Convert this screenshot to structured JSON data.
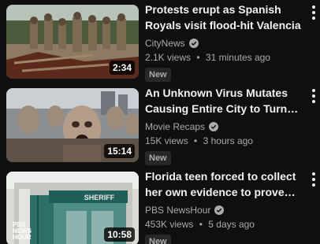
{
  "videos": [
    {
      "title": "Protests erupt as Spanish Royals visit flood-hit Valencia",
      "channel": "CityNews",
      "views": "2.1K views",
      "age": "31 minutes ago",
      "badge": "New",
      "duration": "2:34",
      "verified": true
    },
    {
      "title": "An Unknown Virus Mutates Causing Entire City to Turn Int…",
      "channel": "Movie Recaps",
      "views": "15K views",
      "age": "3 hours ago",
      "badge": "New",
      "duration": "15:14",
      "verified": true
    },
    {
      "title": "Florida teen forced to collect her own evidence to prove she…",
      "channel": "PBS NewsHour",
      "views": "453K views",
      "age": "5 days ago",
      "badge": "New",
      "duration": "10:58",
      "verified": true,
      "thumb_sign": "SHERIFF",
      "thumb_logo": [
        "PBS",
        "NEWS",
        "HOUR"
      ]
    }
  ],
  "separator": "•",
  "icons": {
    "verified": "check-circle-icon",
    "menu": "more-vert-icon"
  }
}
